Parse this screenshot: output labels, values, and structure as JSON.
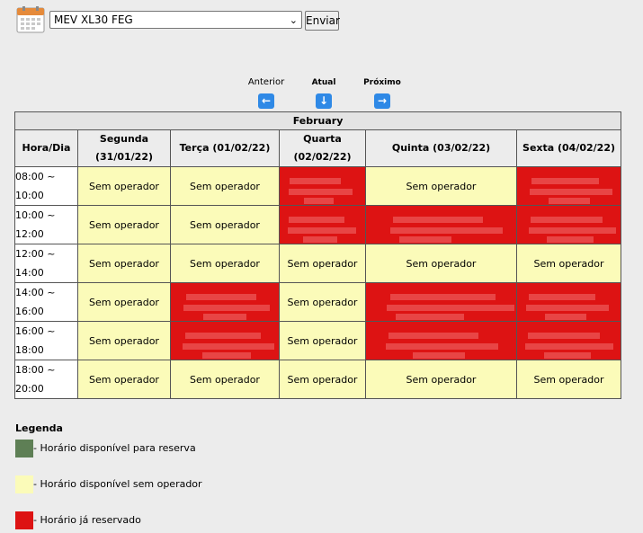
{
  "toolbar": {
    "equipment_selected": "MEV XL30 FEG",
    "send_label": "Enviar"
  },
  "navigation": {
    "prev_label": "Anterior",
    "current_label": "Atual",
    "next_label": "Próximo"
  },
  "schedule": {
    "month": "February",
    "headers": [
      "Hora/Dia",
      "Segunda (31/01/22)",
      "Terça (01/02/22)",
      "Quarta (02/02/22)",
      "Quinta (03/02/22)",
      "Sexta (04/02/22)"
    ],
    "free_text": "Sem operador",
    "rows": [
      {
        "time": "08:00 ~ 10:00",
        "cells": [
          "free",
          "free",
          "reserved",
          "free",
          "reserved"
        ]
      },
      {
        "time": "10:00 ~ 12:00",
        "cells": [
          "free",
          "free",
          "reserved",
          "reserved",
          "reserved"
        ]
      },
      {
        "time": "12:00 ~ 14:00",
        "cells": [
          "free",
          "free",
          "free",
          "free",
          "free"
        ]
      },
      {
        "time": "14:00 ~ 16:00",
        "cells": [
          "free",
          "reserved",
          "free",
          "reserved",
          "reserved"
        ]
      },
      {
        "time": "16:00 ~ 18:00",
        "cells": [
          "free",
          "reserved",
          "free",
          "reserved",
          "reserved"
        ]
      },
      {
        "time": "18:00 ~ 20:00",
        "cells": [
          "free",
          "free",
          "free",
          "free",
          "free"
        ]
      }
    ]
  },
  "legend": {
    "title": "Legenda",
    "items": [
      {
        "color": "#5e7f55",
        "label": "- Horário disponível para reserva"
      },
      {
        "color": "#fbfbb9",
        "label": "- Horário disponível sem operador"
      },
      {
        "color": "#dd1313",
        "label": "- Horário já reservado"
      }
    ]
  },
  "colors": {
    "free": "#fbfbb9",
    "reserved": "#dd1313",
    "available": "#5e7f55",
    "nav_button": "#2f89e6"
  }
}
